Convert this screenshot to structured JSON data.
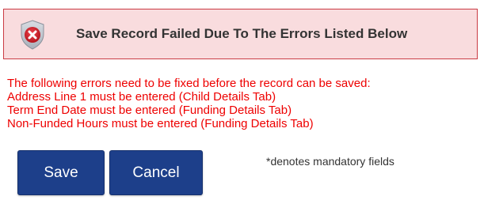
{
  "banner": {
    "icon": "shield-error-icon",
    "title": "Save Record Failed Due To The Errors Listed Below",
    "background_color": "#f9dcde",
    "border_color": "#ca3b44"
  },
  "errors": {
    "intro": "The following errors need to be fixed before the record can be saved:",
    "items": [
      "Address Line 1 must be entered (Child Details Tab)",
      "Term End Date must be entered (Funding Details Tab)",
      "Non-Funded Hours must be entered (Funding Details Tab)"
    ],
    "color": "#ee0000"
  },
  "actions": {
    "save_label": "Save",
    "cancel_label": "Cancel",
    "button_color": "#1d3f8a"
  },
  "mandatory_note": "*denotes mandatory fields"
}
